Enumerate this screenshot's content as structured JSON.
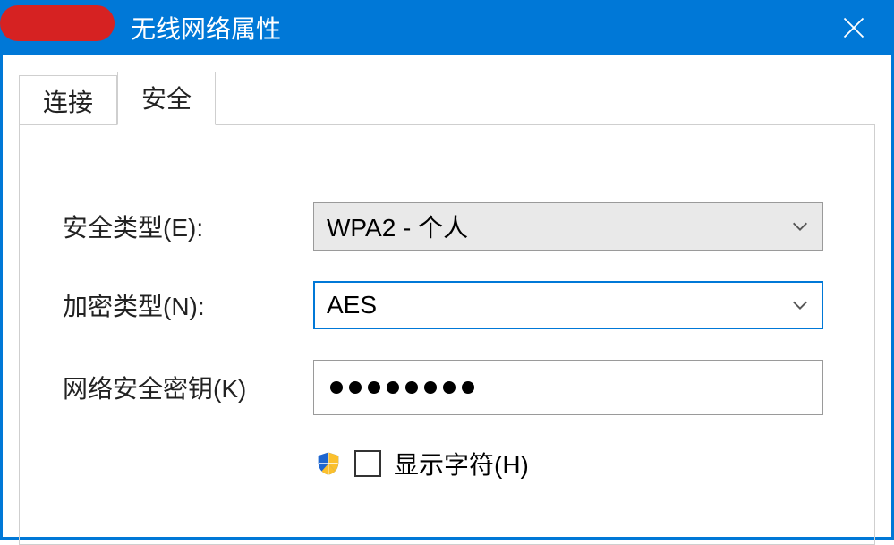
{
  "window": {
    "title": "无线网络属性",
    "redacted_prefix": true
  },
  "tabs": {
    "items": [
      {
        "label": "连接",
        "active": false
      },
      {
        "label": "安全",
        "active": true
      }
    ]
  },
  "form": {
    "security_type": {
      "label": "安全类型(E):",
      "value": "WPA2 - 个人"
    },
    "encryption_type": {
      "label": "加密类型(N):",
      "value": "AES"
    },
    "network_key": {
      "label": "网络安全密钥(K)",
      "masked_len": 8
    },
    "show_chars": {
      "label": "显示字符(H)",
      "checked": false
    }
  }
}
